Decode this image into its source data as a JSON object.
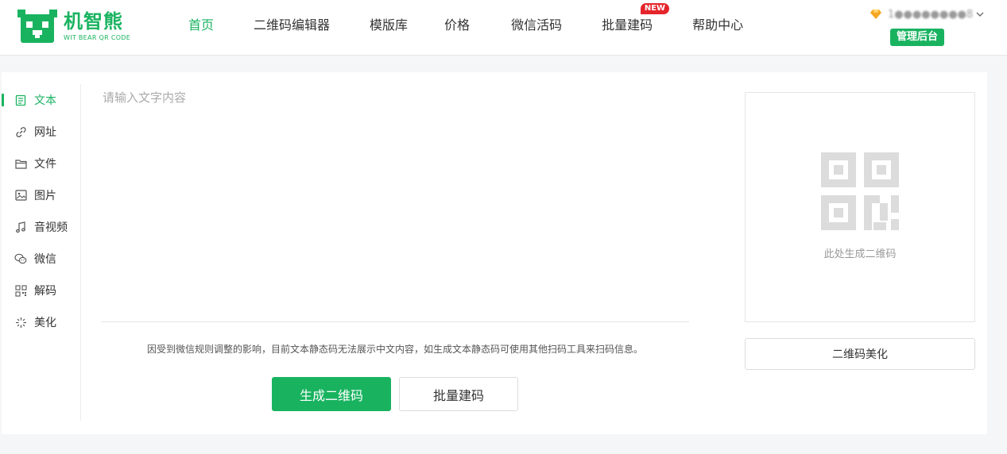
{
  "brand": {
    "name_cn": "机智熊",
    "name_en": "WIT BEAR QR CODE",
    "color": "#19b360"
  },
  "nav": {
    "items": [
      {
        "label": "首页",
        "active": true
      },
      {
        "label": "二维码编辑器"
      },
      {
        "label": "模版库"
      },
      {
        "label": "价格"
      },
      {
        "label": "微信活码"
      },
      {
        "label": "批量建码",
        "badge": "NEW"
      },
      {
        "label": "帮助中心"
      }
    ]
  },
  "user": {
    "name": "1●●●●●●●●8",
    "vip_icon": "diamond-icon",
    "admin_label": "管理后台"
  },
  "sidebar": {
    "items": [
      {
        "label": "文本",
        "icon": "document-icon",
        "active": true
      },
      {
        "label": "网址",
        "icon": "link-icon"
      },
      {
        "label": "文件",
        "icon": "folder-icon"
      },
      {
        "label": "图片",
        "icon": "image-icon"
      },
      {
        "label": "音视频",
        "icon": "music-icon"
      },
      {
        "label": "微信",
        "icon": "wechat-icon"
      },
      {
        "label": "解码",
        "icon": "grid-icon"
      },
      {
        "label": "美化",
        "icon": "sparkle-icon"
      }
    ]
  },
  "editor": {
    "placeholder": "请输入文字内容",
    "value": ""
  },
  "notice": "因受到微信规则调整的影响，目前文本静态码无法展示中文内容，如生成文本静态码可使用其他扫码工具来扫码信息。",
  "actions": {
    "generate_label": "生成二维码",
    "batch_label": "批量建码"
  },
  "preview": {
    "caption": "此处生成二维码",
    "beautify_label": "二维码美化"
  }
}
